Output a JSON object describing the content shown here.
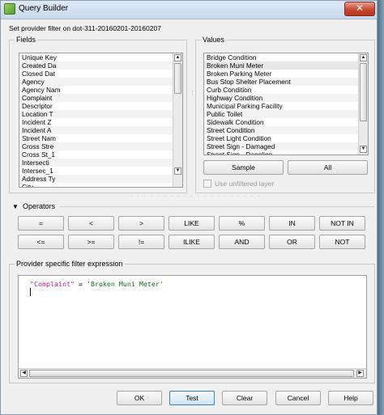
{
  "window": {
    "title": "Query Builder",
    "close_label": "✕"
  },
  "provider_filter_label": "Set provider filter on dot-311-20160201-20160207",
  "fields": {
    "title": "Fields",
    "items": [
      "Unique Key",
      "Created Da",
      "Closed Dat",
      "Agency",
      "Agency Nam",
      "Complaint",
      "Descriptor",
      "Location T",
      "Incident Z",
      "Incident A",
      "Street Nam",
      "Cross Stre",
      "Cross St_1",
      "Intersecti",
      "Intersec_1",
      "Address Ty",
      "City"
    ]
  },
  "values": {
    "title": "Values",
    "items": [
      "Bridge Condition",
      "Broken Muni Meter",
      "Broken Parking Meter",
      "Bus Stop Shelter Placement",
      "Curb Condition",
      "Highway Condition",
      "Municipal Parking Facility",
      "Public Toilet",
      "Sidewalk Condition",
      "Street Condition",
      "Street Light Condition",
      "Street Sign - Damaged",
      "Street Sign - Dangling"
    ],
    "sample_label": "Sample",
    "all_label": "All",
    "use_unfiltered_label": "Use unfiltered layer"
  },
  "operators": {
    "title": "Operators",
    "row1": [
      "=",
      "<",
      ">",
      "LIKE",
      "%",
      "IN",
      "NOT IN"
    ],
    "row2": [
      "<=",
      ">=",
      "!=",
      "ILIKE",
      "AND",
      "OR",
      "NOT"
    ]
  },
  "expression": {
    "title": "Provider specific filter expression",
    "field": "\"Complaint\"",
    "operator": " = ",
    "value": "'Broken Muni Meter'"
  },
  "buttons": {
    "ok": "OK",
    "test": "Test",
    "clear": "Clear",
    "cancel": "Cancel",
    "help": "Help"
  },
  "colors": {
    "field_string": "#c0199b",
    "value_string": "#1e6b1e",
    "focus_border": "#3c7fb1"
  }
}
